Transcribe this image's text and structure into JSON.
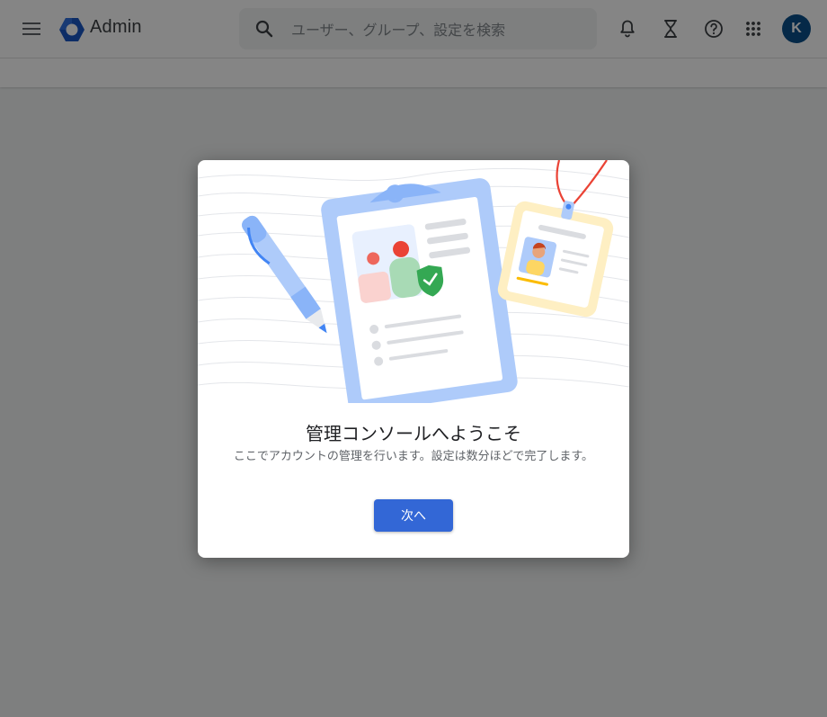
{
  "header": {
    "brand": "Admin",
    "search": {
      "placeholder": "ユーザー、グループ、設定を検索"
    },
    "avatar_initial": "K"
  },
  "dialog": {
    "title": "管理コンソールへようこそ",
    "body": "ここでアカウントの管理を行います。設定は数分ほどで完了します。",
    "next_label": "次へ"
  },
  "icons": {
    "menu": "hamburger-menu-icon",
    "logo": "admin-hexagon-logo",
    "search": "magnifier-icon",
    "notifications": "bell-icon",
    "tasks": "hourglass-icon",
    "help": "question-circle-icon",
    "apps": "grid-apps-icon"
  },
  "colors": {
    "primary_button": "#3367d6",
    "avatar": "#0b4f8a",
    "logo_blue": "#1a56c4",
    "check_green": "#34a853"
  }
}
